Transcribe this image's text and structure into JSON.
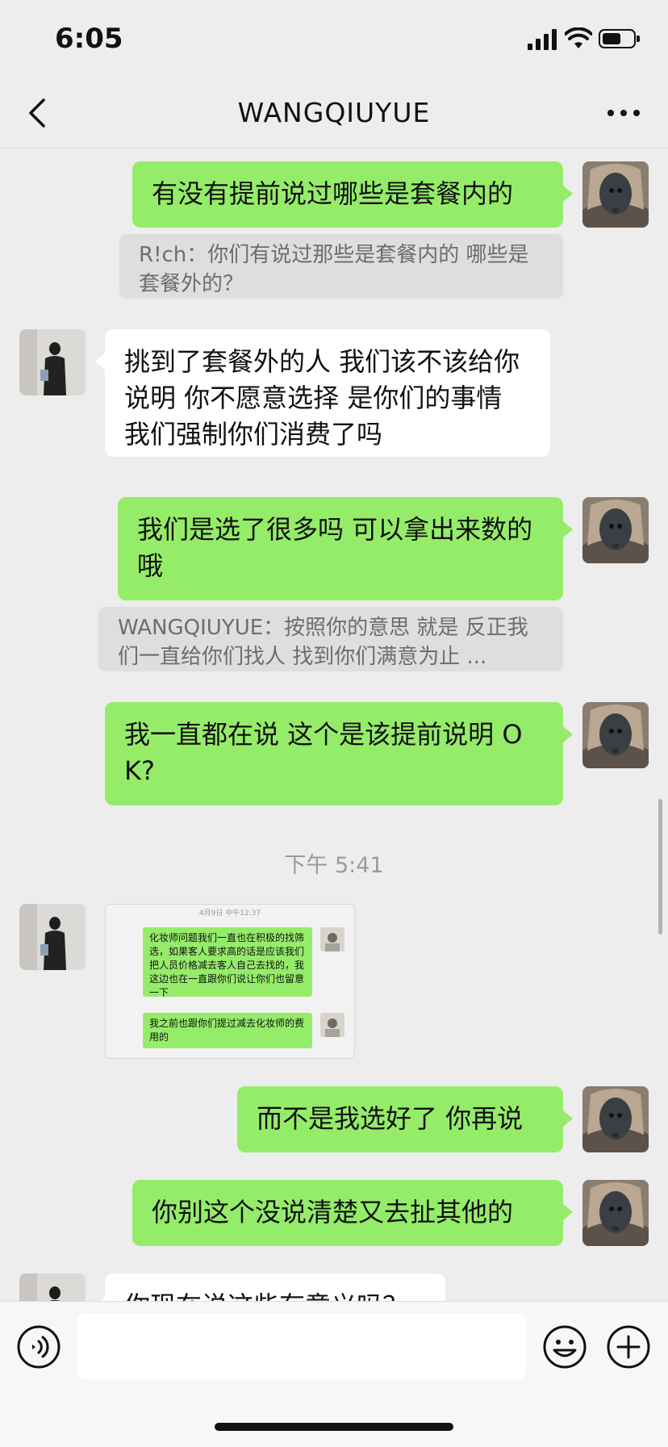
{
  "status_bar": {
    "time": "6:05",
    "battery_level": 0.6
  },
  "header": {
    "title": "WANGQIUYUE",
    "back_icon": "chevron-left-icon",
    "more_icon": "ellipsis-icon"
  },
  "messages": [
    {
      "side": "right",
      "text": "有没有提前说过哪些是套餐内的"
    },
    {
      "side": "quote",
      "text": "R!ch：你们有说过那些是套餐内的  哪些是套餐外的？"
    },
    {
      "side": "left",
      "text": "挑到了套餐外的人 我们该不该给你说明 你不愿意选择 是你们的事情 我们强制你们消费了吗"
    },
    {
      "side": "right",
      "text": "我们是选了很多吗  可以拿出来数的哦"
    },
    {
      "side": "quote",
      "text": "WANGQIUYUE：按照你的意思 就是 反正我们一直给你们找人 找到你们满意为止 ..."
    },
    {
      "side": "right",
      "text": "我一直都在说  这个是该提前说明 OK?"
    },
    {
      "side": "timestamp",
      "text": "下午 5:41"
    },
    {
      "side": "left-image",
      "image": {
        "date": "4月9日 中午12:37",
        "bubbles": [
          "化妆师问题我们一直也在积极的找筛选，如果客人要求高的话是应该我们把人员价格减去客人自己去找的，我这边也在一直跟你们说让你们也留意一下",
          "我之前也跟你们提过减去化妆师的费用的"
        ]
      }
    },
    {
      "side": "right",
      "text": "而不是我选好了 你再说"
    },
    {
      "side": "right",
      "text": "你别这个没说清楚又去扯其他的"
    },
    {
      "side": "left",
      "text": "你现在说这些有意义吗？"
    }
  ],
  "input_bar": {
    "placeholder": "",
    "voice_icon": "voice-icon",
    "emoji_icon": "emoji-icon",
    "plus_icon": "plus-icon"
  },
  "colors": {
    "sent_bubble": "#95ec69",
    "received_bubble": "#ffffff",
    "background": "#ededed"
  }
}
